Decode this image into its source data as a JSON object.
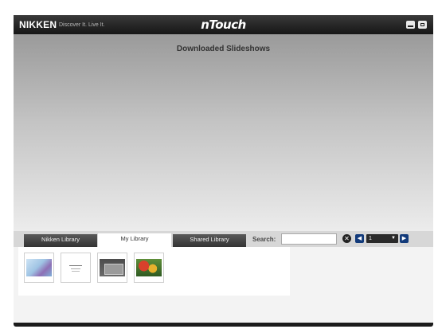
{
  "window": {
    "brand": "NIKKEN",
    "tagline": "Discover It. Live It.",
    "app_title": "nTouch",
    "minimize_icon": "minimize-icon",
    "close_icon": "close-icon"
  },
  "stage": {
    "title": "Downloaded Slideshows"
  },
  "tabs": {
    "items": [
      {
        "label": "Nikken Library",
        "active": false
      },
      {
        "label": "My Library",
        "active": true
      },
      {
        "label": "Shared Library",
        "active": false
      }
    ]
  },
  "search": {
    "label": "Search:",
    "value": "",
    "placeholder": "",
    "clear_icon": "clear-icon"
  },
  "pagination": {
    "prev_icon": "arrow-left-icon",
    "next_icon": "arrow-right-icon",
    "selected_page": "1",
    "dropdown_icon": "chevron-down-icon"
  },
  "library": {
    "thumbnails": [
      {
        "name": "slideshow-thumbnail-1",
        "colors": [
          "#b9d7f0",
          "#8e6fb5"
        ]
      },
      {
        "name": "slideshow-thumbnail-2",
        "colors": [
          "#ffffff",
          "#999999"
        ]
      },
      {
        "name": "slideshow-thumbnail-3",
        "colors": [
          "#5a5a5a",
          "#9a9a9a"
        ]
      },
      {
        "name": "slideshow-thumbnail-4",
        "colors": [
          "#b53a2a",
          "#3d7a2a"
        ]
      }
    ]
  }
}
